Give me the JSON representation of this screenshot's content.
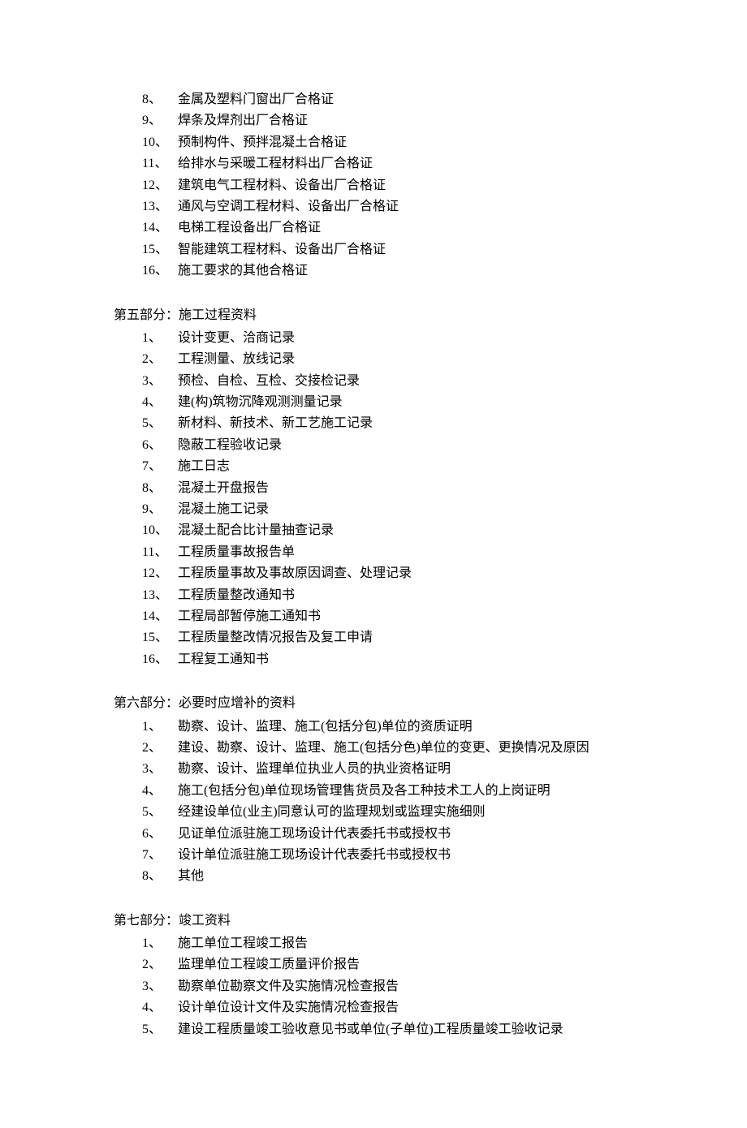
{
  "topList": [
    {
      "num": "8、",
      "text": "金属及塑料门窗出厂合格证"
    },
    {
      "num": "9、",
      "text": "焊条及焊剂出厂合格证"
    },
    {
      "num": "10、",
      "text": "预制构件、预拌混凝土合格证"
    },
    {
      "num": "11、",
      "text": "给排水与采暖工程材料出厂合格证"
    },
    {
      "num": "12、",
      "text": "建筑电气工程材料、设备出厂合格证"
    },
    {
      "num": "13、",
      "text": "通风与空调工程材料、设备出厂合格证"
    },
    {
      "num": "14、",
      "text": "电梯工程设备出厂合格证"
    },
    {
      "num": "15、",
      "text": "智能建筑工程材料、设备出厂合格证"
    },
    {
      "num": "16、",
      "text": "施工要求的其他合格证"
    }
  ],
  "sections": [
    {
      "heading": "第五部分：施工过程资料",
      "items": [
        {
          "num": "1、",
          "text": "设计变更、洽商记录"
        },
        {
          "num": "2、",
          "text": "工程测量、放线记录"
        },
        {
          "num": "3、",
          "text": "预检、自检、互检、交接检记录"
        },
        {
          "num": "4、",
          "text": "建(构)筑物沉降观测测量记录"
        },
        {
          "num": "5、",
          "text": "新材料、新技术、新工艺施工记录"
        },
        {
          "num": "6、",
          "text": "隐蔽工程验收记录"
        },
        {
          "num": "7、",
          "text": "施工日志"
        },
        {
          "num": "8、",
          "text": "混凝土开盘报告"
        },
        {
          "num": "9、",
          "text": "混凝土施工记录"
        },
        {
          "num": "10、",
          "text": "混凝土配合比计量抽查记录"
        },
        {
          "num": "11、",
          "text": "工程质量事故报告单"
        },
        {
          "num": "12、",
          "text": "工程质量事故及事故原因调查、处理记录"
        },
        {
          "num": "13、",
          "text": "工程质量整改通知书"
        },
        {
          "num": "14、",
          "text": "工程局部暂停施工通知书"
        },
        {
          "num": "15、",
          "text": "工程质量整改情况报告及复工申请"
        },
        {
          "num": "16、",
          "text": "工程复工通知书"
        }
      ]
    },
    {
      "heading": "第六部分：必要时应增补的资料",
      "items": [
        {
          "num": "1、",
          "text": "勘察、设计、监理、施工(包括分包)单位的资质证明"
        },
        {
          "num": "2、",
          "text": "建设、勘察、设计、监理、施工(包括分色)单位的变更、更换情况及原因"
        },
        {
          "num": "3、",
          "text": "勘察、设计、监理单位执业人员的执业资格证明"
        },
        {
          "num": "4、",
          "text": "施工(包括分包)单位现场管理售货员及各工种技术工人的上岗证明"
        },
        {
          "num": "5、",
          "text": "经建设单位(业主)同意认可的监理规划或监理实施细则"
        },
        {
          "num": "6、",
          "text": "见证单位派驻施工现场设计代表委托书或授权书"
        },
        {
          "num": "7、",
          "text": "设计单位派驻施工现场设计代表委托书或授权书"
        },
        {
          "num": "8、",
          "text": "其他"
        }
      ]
    },
    {
      "heading": "第七部分：竣工资料",
      "items": [
        {
          "num": "1、",
          "text": "施工单位工程竣工报告"
        },
        {
          "num": "2、",
          "text": "监理单位工程竣工质量评价报告"
        },
        {
          "num": "3、",
          "text": "勘察单位勘察文件及实施情况检查报告"
        },
        {
          "num": "4、",
          "text": "设计单位设计文件及实施情况检查报告"
        },
        {
          "num": "5、",
          "text": "建设工程质量竣工验收意见书或单位(子单位)工程质量竣工验收记录"
        }
      ]
    }
  ]
}
